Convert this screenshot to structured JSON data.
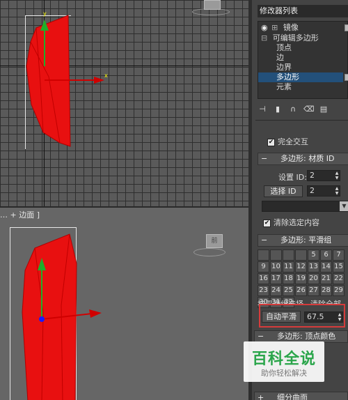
{
  "viewport_bottom": {
    "label": "… + 边面 ]"
  },
  "modifier_list": {
    "label": "修改器列表"
  },
  "stack": {
    "items": [
      {
        "label": "镜像",
        "selected": false
      },
      {
        "label": "可编辑多边形",
        "selected": false
      },
      {
        "label": "顶点",
        "selected": false
      },
      {
        "label": "边",
        "selected": false
      },
      {
        "label": "边界",
        "selected": false
      },
      {
        "label": "多边形",
        "selected": true
      },
      {
        "label": "元素",
        "selected": false
      }
    ]
  },
  "selection_partial": {
    "check_label": "完全交互"
  },
  "material_id": {
    "title": "多边形: 材质 ID",
    "set_id_label": "设置 ID:",
    "set_id_value": "2",
    "select_id_button": "选择 ID",
    "select_id_value": "2",
    "clear_selection_label": "清除选定内容"
  },
  "smoothing": {
    "title": "多边形: 平滑组",
    "grid": [
      "",
      "",
      "",
      "",
      "5",
      "6",
      "7",
      "9",
      "10",
      "11",
      "12",
      "13",
      "14",
      "15",
      "16",
      "17",
      "18",
      "19",
      "20",
      "21",
      "22",
      "23",
      "24",
      "25",
      "26",
      "27",
      "28",
      "29",
      "30",
      "31",
      "32"
    ],
    "select_by_sg": "按平滑组选择",
    "clear_all": "清除全部",
    "auto_smooth_button": "自动平滑",
    "auto_smooth_value": "67.5"
  },
  "vertex_colors": {
    "title": "多边形: 顶点颜色"
  },
  "subdivide": {
    "title": "细分曲面"
  },
  "watermark": {
    "main": "百科全说",
    "sub": "助你轻松解决"
  },
  "colors": {
    "object_red": "#e81010",
    "selection_blue": "#23507a",
    "highlight_red": "#d63b3b",
    "watermark_green": "#2aa54a"
  },
  "icons": [
    "y-axis-gizmo-icon",
    "x-axis-gizmo-icon",
    "nav-cube-icon",
    "pin-stack-icon",
    "show-end-result-icon",
    "make-unique-icon",
    "remove-modifier-icon",
    "configure-sets-icon"
  ]
}
